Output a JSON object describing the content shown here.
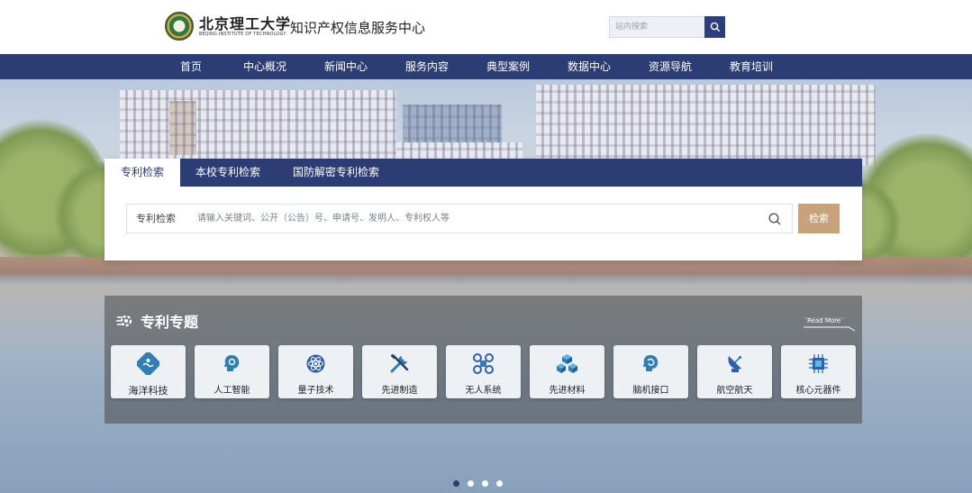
{
  "header": {
    "logo_cn": "北京理工大学",
    "logo_en": "BEIJING INSTITUTE OF TECHNOLOGY",
    "title": "知识产权信息服务中心",
    "search_placeholder": "站内搜索",
    "search_icon": "search-icon"
  },
  "nav": {
    "items": [
      {
        "label": "首页"
      },
      {
        "label": "中心概况"
      },
      {
        "label": "新闻中心"
      },
      {
        "label": "服务内容"
      },
      {
        "label": "典型案例"
      },
      {
        "label": "数据中心"
      },
      {
        "label": "资源导航"
      },
      {
        "label": "教育培训"
      }
    ]
  },
  "search": {
    "tabs": [
      {
        "label": "专利检索",
        "active": true
      },
      {
        "label": "本校专利检索",
        "active": false
      },
      {
        "label": "国防解密专利检索",
        "active": false
      }
    ],
    "type_label": "专利检索",
    "placeholder": "请输入关键词、公开（公告）号、申请号、发明人、专利权人等",
    "button_label": "检索"
  },
  "topics": {
    "title": "专利专题",
    "read_more": "Read More",
    "items": [
      {
        "label": "海洋科技",
        "icon": "ocean-icon"
      },
      {
        "label": "人工智能",
        "icon": "ai-head-icon"
      },
      {
        "label": "量子技术",
        "icon": "quantum-icon"
      },
      {
        "label": "先进制造",
        "icon": "tools-icon"
      },
      {
        "label": "无人系统",
        "icon": "drone-icon"
      },
      {
        "label": "先进材料",
        "icon": "cubes-icon"
      },
      {
        "label": "脑机接口",
        "icon": "brain-icon"
      },
      {
        "label": "航空航天",
        "icon": "satellite-icon"
      },
      {
        "label": "核心元器件",
        "icon": "chip-icon"
      }
    ]
  },
  "slider": {
    "count": 4,
    "active_index": 0
  },
  "colors": {
    "primary": "#2b3d74",
    "accent": "#c8a27a"
  }
}
